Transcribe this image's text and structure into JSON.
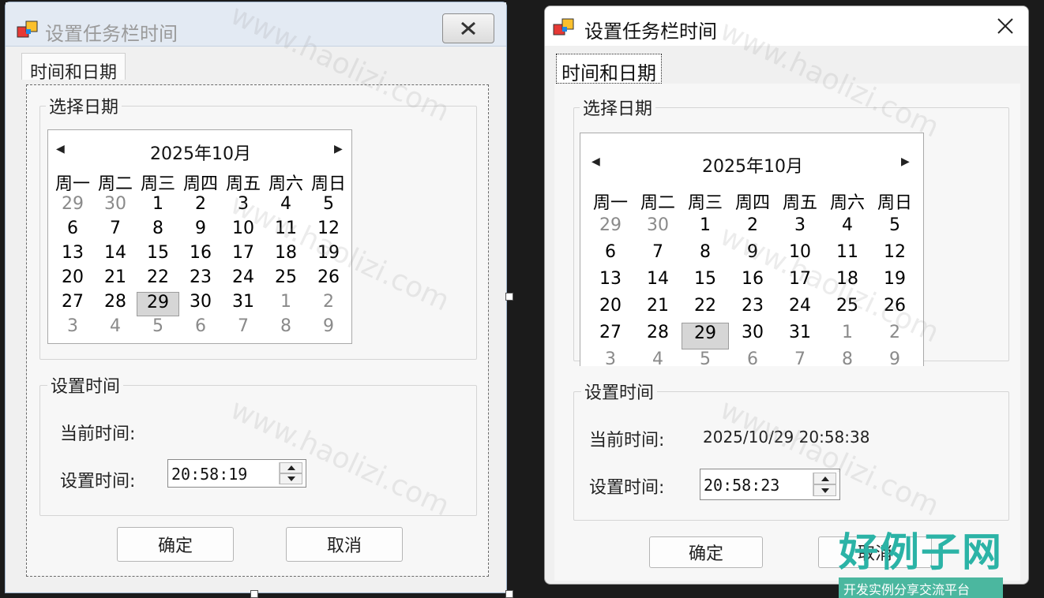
{
  "designer": {
    "title": "设置任务栏时间",
    "tab_label": "时间和日期",
    "date_group_title": "选择日期",
    "time_group_title": "设置时间",
    "calendar": {
      "month_label": "2025年10月",
      "prev_arrow": "◀",
      "next_arrow": "▶",
      "weekdays": [
        "周一",
        "周二",
        "周三",
        "周四",
        "周五",
        "周六",
        "周日"
      ],
      "selected_day": "29"
    },
    "current_time_label": "当前时间:",
    "current_time_value": "",
    "set_time_label": "设置时间:",
    "set_time_value": "20:58:19",
    "ok_label": "确定",
    "cancel_label": "取消"
  },
  "running": {
    "title": "设置任务栏时间",
    "tab_label": "时间和日期",
    "date_group_title": "选择日期",
    "time_group_title": "设置时间",
    "calendar": {
      "month_label": "2025年10月",
      "prev_arrow": "◀",
      "next_arrow": "▶",
      "weekdays": [
        "周一",
        "周二",
        "周三",
        "周四",
        "周五",
        "周六",
        "周日"
      ],
      "selected_day": "29"
    },
    "current_time_label": "当前时间:",
    "current_time_value": "2025/10/29 20:58:38",
    "set_time_label": "设置时间:",
    "set_time_value": "20:58:23",
    "ok_label": "确定",
    "cancel_label": "取消"
  },
  "calendar_days": [
    {
      "d": "29",
      "o": true
    },
    {
      "d": "30",
      "o": true
    },
    {
      "d": "1",
      "o": false
    },
    {
      "d": "2",
      "o": false
    },
    {
      "d": "3",
      "o": false
    },
    {
      "d": "4",
      "o": false
    },
    {
      "d": "5",
      "o": false
    },
    {
      "d": "6",
      "o": false
    },
    {
      "d": "7",
      "o": false
    },
    {
      "d": "8",
      "o": false
    },
    {
      "d": "9",
      "o": false
    },
    {
      "d": "10",
      "o": false
    },
    {
      "d": "11",
      "o": false
    },
    {
      "d": "12",
      "o": false
    },
    {
      "d": "13",
      "o": false
    },
    {
      "d": "14",
      "o": false
    },
    {
      "d": "15",
      "o": false
    },
    {
      "d": "16",
      "o": false
    },
    {
      "d": "17",
      "o": false
    },
    {
      "d": "18",
      "o": false
    },
    {
      "d": "19",
      "o": false
    },
    {
      "d": "20",
      "o": false
    },
    {
      "d": "21",
      "o": false
    },
    {
      "d": "22",
      "o": false
    },
    {
      "d": "23",
      "o": false
    },
    {
      "d": "24",
      "o": false
    },
    {
      "d": "25",
      "o": false
    },
    {
      "d": "26",
      "o": false
    },
    {
      "d": "27",
      "o": false
    },
    {
      "d": "28",
      "o": false
    },
    {
      "d": "29",
      "o": false
    },
    {
      "d": "30",
      "o": false
    },
    {
      "d": "31",
      "o": false
    },
    {
      "d": "1",
      "o": true
    },
    {
      "d": "2",
      "o": true
    },
    {
      "d": "3",
      "o": true
    },
    {
      "d": "4",
      "o": true
    },
    {
      "d": "5",
      "o": true
    },
    {
      "d": "6",
      "o": true
    },
    {
      "d": "7",
      "o": true
    },
    {
      "d": "8",
      "o": true
    },
    {
      "d": "9",
      "o": true
    }
  ],
  "watermark": "www.haolizi.com",
  "brand": {
    "name": "好例子网",
    "tagline": "开发实例分享交流平台"
  },
  "colors": {
    "accent_teal": "#2bb3a6",
    "selected_day_bg": "#d6d6d6",
    "window_bg": "#f0f0f0"
  }
}
